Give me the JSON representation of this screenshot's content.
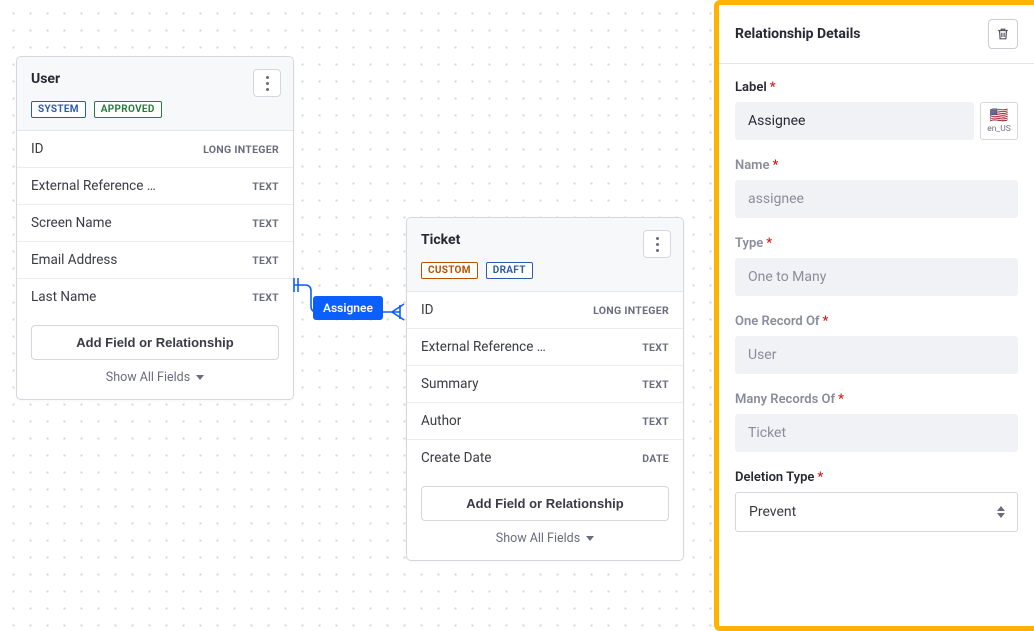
{
  "canvas": {
    "relationship_pill": "Assignee",
    "entities": {
      "user": {
        "title": "User",
        "badges": {
          "system": "SYSTEM",
          "approved": "APPROVED"
        },
        "fields": [
          {
            "name": "ID",
            "type": "LONG INTEGER"
          },
          {
            "name": "External Reference …",
            "type": "TEXT"
          },
          {
            "name": "Screen Name",
            "type": "TEXT"
          },
          {
            "name": "Email Address",
            "type": "TEXT"
          },
          {
            "name": "Last Name",
            "type": "TEXT"
          }
        ],
        "add_btn": "Add Field or Relationship",
        "show_all": "Show All Fields"
      },
      "ticket": {
        "title": "Ticket",
        "badges": {
          "custom": "CUSTOM",
          "draft": "DRAFT"
        },
        "fields": [
          {
            "name": "ID",
            "type": "LONG INTEGER"
          },
          {
            "name": "External Reference …",
            "type": "TEXT"
          },
          {
            "name": "Summary",
            "type": "TEXT"
          },
          {
            "name": "Author",
            "type": "TEXT"
          },
          {
            "name": "Create Date",
            "type": "DATE"
          }
        ],
        "add_btn": "Add Field or Relationship",
        "show_all": "Show All Fields"
      }
    }
  },
  "sidebar": {
    "title": "Relationship Details",
    "label": {
      "text": "Label",
      "value": "Assignee",
      "locale": "en_US"
    },
    "name": {
      "text": "Name",
      "value": "assignee"
    },
    "type": {
      "text": "Type",
      "value": "One to Many"
    },
    "one_of": {
      "text": "One Record Of",
      "value": "User"
    },
    "many_of": {
      "text": "Many Records Of",
      "value": "Ticket"
    },
    "deletion": {
      "text": "Deletion Type",
      "value": "Prevent"
    }
  }
}
